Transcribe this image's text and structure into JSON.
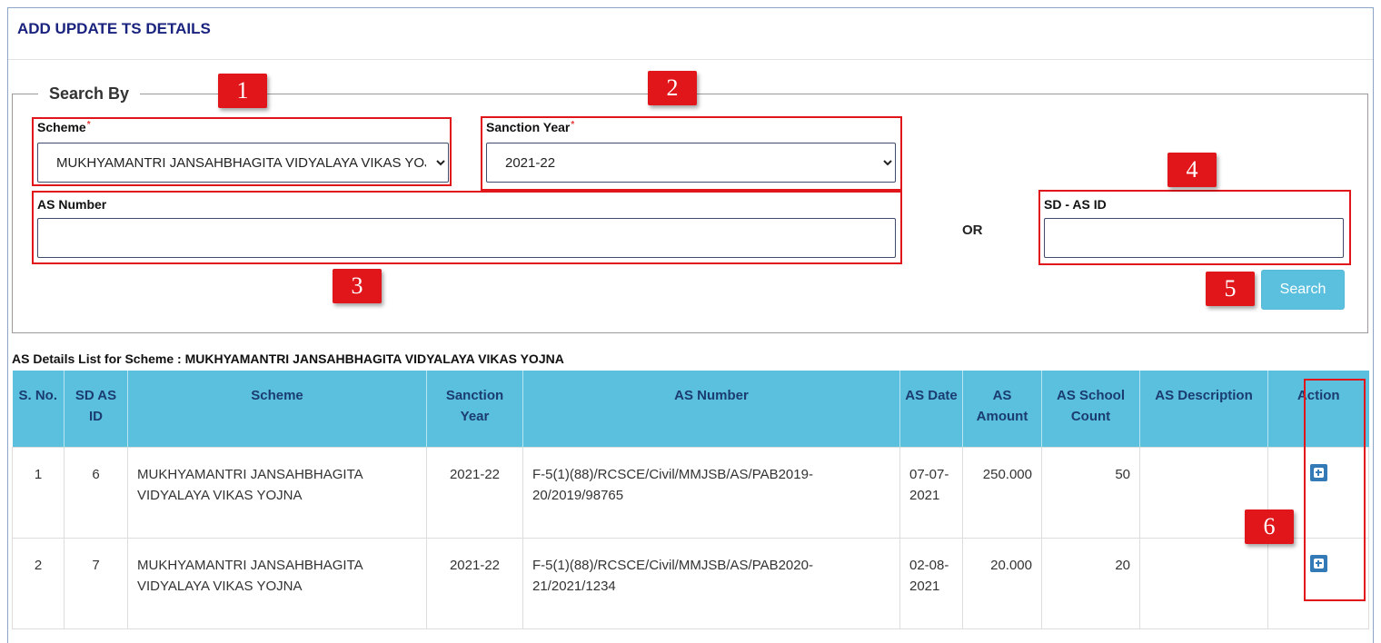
{
  "header": {
    "title": "ADD UPDATE TS DETAILS"
  },
  "search": {
    "legend": "Search By",
    "scheme_label": "Scheme",
    "scheme_value": "MUKHYAMANTRI JANSAHBHAGITA VIDYALAYA VIKAS YOJNA",
    "year_label": "Sanction Year",
    "year_value": "2021-22",
    "required_mark": "*",
    "as_number_label": "AS Number",
    "as_number_value": "",
    "or_text": "OR",
    "sd_as_id_label": "SD - AS ID",
    "sd_as_id_value": "",
    "search_button": "Search"
  },
  "markers": [
    "1",
    "2",
    "3",
    "4",
    "5",
    "6"
  ],
  "list": {
    "title": "AS Details List for Scheme : MUKHYAMANTRI JANSAHBHAGITA VIDYALAYA VIKAS YOJNA",
    "columns": [
      "S. No.",
      "SD AS ID",
      "Scheme",
      "Sanction Year",
      "AS Number",
      "AS Date",
      "AS Amount",
      "AS School Count",
      "AS Description",
      "Action"
    ],
    "rows": [
      {
        "sno": "1",
        "sd_as_id": "6",
        "scheme": "MUKHYAMANTRI JANSAHBHAGITA VIDYALAYA VIKAS YOJNA",
        "year": "2021-22",
        "as_number": "F-5(1)(88)/RCSCE/Civil/MMJSB/AS/PAB2019-20/2019/98765",
        "as_date": "07-07-2021",
        "amount": "250.000",
        "school_count": "50",
        "description": ""
      },
      {
        "sno": "2",
        "sd_as_id": "7",
        "scheme": "MUKHYAMANTRI JANSAHBHAGITA VIDYALAYA VIKAS YOJNA",
        "year": "2021-22",
        "as_number": "F-5(1)(88)/RCSCE/Civil/MMJSB/AS/PAB2020-21/2021/1234",
        "as_date": "02-08-2021",
        "amount": "20.000",
        "school_count": "20",
        "description": ""
      }
    ]
  },
  "colors": {
    "title": "#1a237e",
    "header_bg": "#5bc0de",
    "header_text": "#1a3c6e",
    "annotation": "#e0161b",
    "action_button": "#337ab7"
  }
}
